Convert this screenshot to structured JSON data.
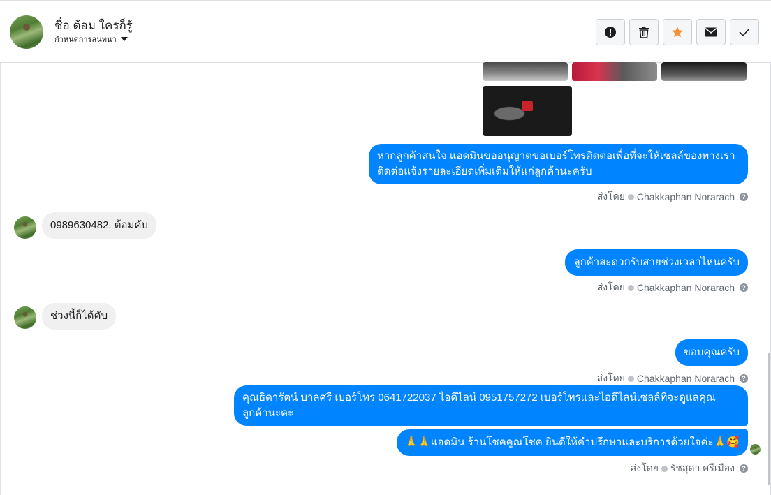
{
  "header": {
    "contact_name": "ชื่อ ต้อม ใครก็รู้",
    "assign_label": "กำหนดการสนทนา"
  },
  "actions": [
    {
      "icon": "alert-icon"
    },
    {
      "icon": "trash-icon"
    },
    {
      "icon": "star-icon",
      "color": "#f7923a"
    },
    {
      "icon": "envelope-icon"
    },
    {
      "icon": "check-icon"
    }
  ],
  "messages": {
    "m1": "หากลูกค้าสนใจ แอดมินขออนุญาตขอเบอร์โทรติดต่อเพื่อที่จะให้เซลล์ของทางเรา",
    "m1b": "ติดต่อแจ้งรายละเอียดเพิ่มเติมให้แก่ลูกค้านะครับ",
    "m2": "0989630482. ต้อมคับ",
    "m3": "ลูกค้าสะดวกรับสายช่วงเวลาไหนครับ",
    "m4": "ช่วงนี้ก็ได้คับ",
    "m5": "ขอบคุณครับ",
    "m6": "คุณธิดารัตน์ บาลศรี เบอร์โทร 0641722037  ไอดีไลน์ 0951757272    เบอร์โทรและไอดีไลน์เซลล์ที่จะดูแลคุณ",
    "m6b": "ลูกค้านะคะ",
    "m7": "🙏🙏แอดมิน ร้านโชคคูณโชค ยินดีให้คำปรึกษาและบริการด้วยใจค่ะ🙏🥰"
  },
  "meta": {
    "sent_by": "ส่งโดย",
    "agent1": "Chakkaphan Norarach",
    "agent2": "รัชสุดา ศรีเมือง"
  },
  "colors": {
    "outgoing": "#0084ff",
    "incoming": "#f1f0f0"
  }
}
